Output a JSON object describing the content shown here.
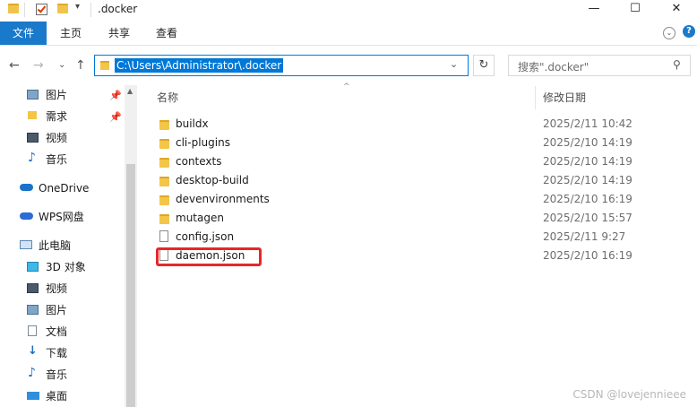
{
  "window": {
    "title": ".docker",
    "controls": {
      "minimize": "—",
      "maximize": "☐",
      "close": "✕"
    }
  },
  "ribbon": {
    "tabs": [
      "文件",
      "主页",
      "共享",
      "查看"
    ],
    "expand_icon": "chevron-down-circle-icon"
  },
  "nav": {
    "address": "C:\\Users\\Administrator\\.docker",
    "search_placeholder": "搜索\".docker\""
  },
  "sidebar": {
    "items": [
      {
        "label": "图片",
        "icon": "pictures-icon",
        "pinned": true
      },
      {
        "label": "需求",
        "icon": "folder-icon",
        "pinned": true
      },
      {
        "label": "视频",
        "icon": "videos-icon"
      },
      {
        "label": "音乐",
        "icon": "music-icon"
      },
      {
        "label": "OneDrive",
        "icon": "onedrive-icon"
      },
      {
        "label": "WPS网盘",
        "icon": "wps-cloud-icon"
      },
      {
        "label": "此电脑",
        "icon": "computer-icon"
      },
      {
        "label": "3D 对象",
        "icon": "3d-objects-icon"
      },
      {
        "label": "视频",
        "icon": "videos-icon"
      },
      {
        "label": "图片",
        "icon": "pictures-icon"
      },
      {
        "label": "文档",
        "icon": "documents-icon"
      },
      {
        "label": "下载",
        "icon": "download-icon"
      },
      {
        "label": "音乐",
        "icon": "music-icon"
      },
      {
        "label": "桌面",
        "icon": "desktop-icon"
      }
    ]
  },
  "filelist": {
    "columns": {
      "name": "名称",
      "modified": "修改日期"
    },
    "rows": [
      {
        "name": "buildx",
        "type": "folder",
        "date": "2025/2/11 10:42"
      },
      {
        "name": "cli-plugins",
        "type": "folder",
        "date": "2025/2/10 14:19"
      },
      {
        "name": "contexts",
        "type": "folder",
        "date": "2025/2/10 14:19"
      },
      {
        "name": "desktop-build",
        "type": "folder",
        "date": "2025/2/10 14:19"
      },
      {
        "name": "devenvironments",
        "type": "folder",
        "date": "2025/2/10 16:19"
      },
      {
        "name": "mutagen",
        "type": "folder",
        "date": "2025/2/10 15:57"
      },
      {
        "name": "config.json",
        "type": "file",
        "date": "2025/2/11 9:27"
      },
      {
        "name": "daemon.json",
        "type": "file",
        "date": "2025/2/10 16:19"
      }
    ]
  },
  "watermark": "CSDN @lovejennieee",
  "colors": {
    "accent": "#0078d7",
    "file_tab": "#1979ca",
    "highlight": "#e8262a",
    "folder": "#f3c548"
  }
}
